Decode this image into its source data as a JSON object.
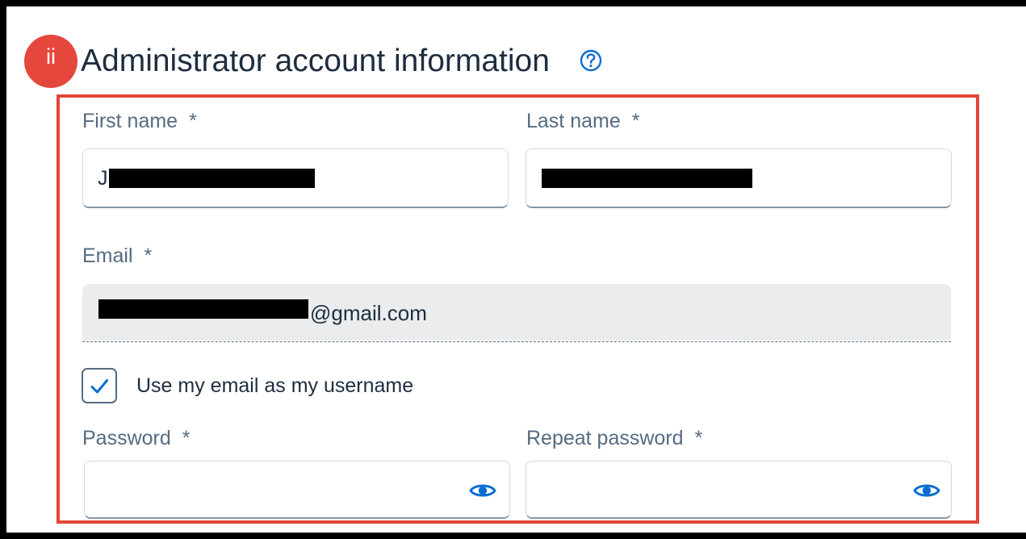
{
  "section": {
    "step_badge": "ii",
    "title": "Administrator account information",
    "help_icon": "question-circle-icon"
  },
  "form": {
    "first_name": {
      "label": "First name",
      "required_mark": "*",
      "value_visible": "J"
    },
    "last_name": {
      "label": "Last name",
      "required_mark": "*",
      "value_visible": ""
    },
    "email": {
      "label": "Email",
      "required_mark": "*",
      "value_visible": "j...@gmail.com",
      "value_suffix": "@gmail.com"
    },
    "use_email_as_username": {
      "label": "Use my email as my username",
      "checked": true
    },
    "password": {
      "label": "Password",
      "required_mark": "*",
      "value": ""
    },
    "repeat_password": {
      "label": "Repeat password",
      "required_mark": "*",
      "value": ""
    }
  },
  "icons": {
    "checkbox_check": "check-icon",
    "password_toggle": "eye-icon",
    "repeat_password_toggle": "eye-icon"
  },
  "colors": {
    "highlight_border": "#e2463a",
    "badge": "#e5473d",
    "accent": "#0a6ed1",
    "label": "#556b82",
    "text": "#1d2d3e"
  }
}
